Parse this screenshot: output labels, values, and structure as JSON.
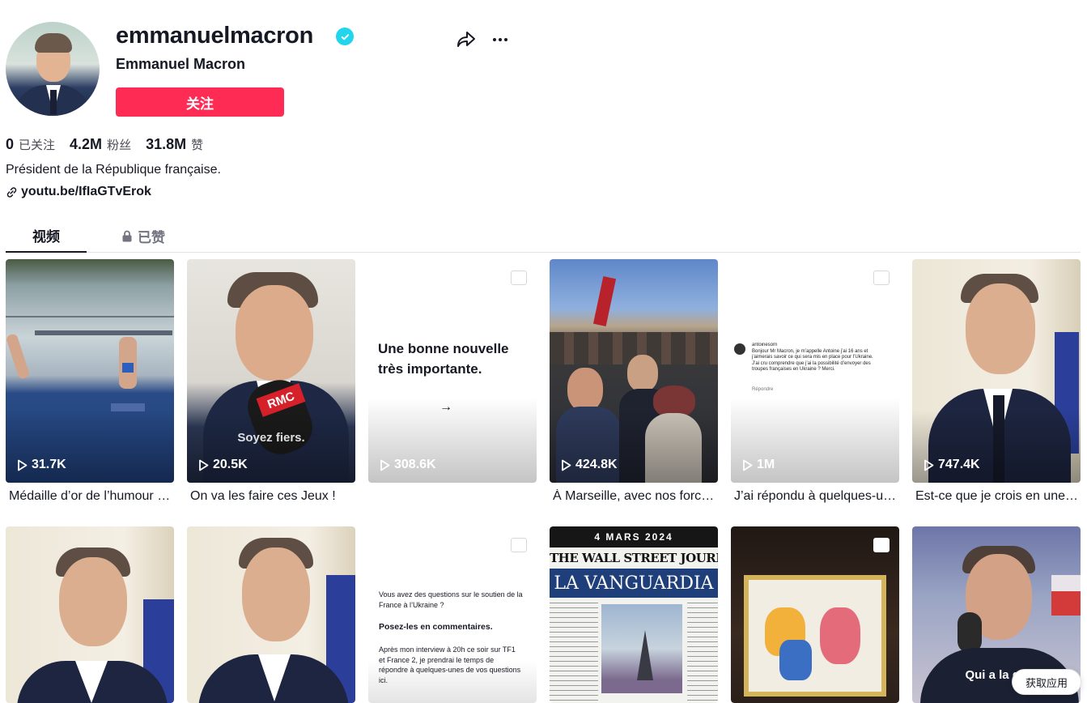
{
  "profile": {
    "username": "emmanuelmacron",
    "nickname": "Emmanuel Macron",
    "follow_label": "关注",
    "bio": "Président de la République française.",
    "link": "youtu.be/IfIaGTvErok"
  },
  "stats": [
    {
      "value": "0",
      "label": "已关注"
    },
    {
      "value": "4.2M",
      "label": "粉丝"
    },
    {
      "value": "31.8M",
      "label": "赞"
    }
  ],
  "tabs": {
    "videos": "视频",
    "liked": "已赞"
  },
  "videos": [
    {
      "views": "31.7K",
      "caption": "Médaille d’or de l’humour des JO"
    },
    {
      "views": "20.5K",
      "caption": "On va les faire ces Jeux !",
      "overlay": "Soyez fiers."
    },
    {
      "views": "308.6K",
      "caption": "",
      "overlay_title": "Une bonne nouvelle très importante.",
      "arrow": "→"
    },
    {
      "views": "424.8K",
      "caption": "À Marseille, avec nos forces de l’ordre"
    },
    {
      "views": "1M",
      "caption": "J’ai répondu à quelques-unes de vos questions",
      "comment": {
        "handle": "antoinesorn",
        "text": "Bonjour Mr Macron, je m’appelle Antoine j’ai 16 ans et j’aimerais savoir ce qui sera mis en place pour l’Ukraine. J’ai cru comprendre que j’ai la possibilité d’envoyer des troupes françaises en Ukraine ? Merci.",
        "reply": "Répondre"
      }
    },
    {
      "views": "747.4K",
      "caption": "Est-ce que je crois en une victoire ?"
    },
    {
      "views": "",
      "caption": ""
    },
    {
      "views": "",
      "caption": ""
    },
    {
      "views": "",
      "caption": "",
      "lines": [
        "Vous avez des questions sur le soutien de la France à l’Ukraine ?",
        "Posez-les en commentaires.",
        "Après mon interview à 20h ce soir sur TF1 et France 2, je prendrai le temps de répondre à quelques-unes de vos questions ici."
      ]
    },
    {
      "views": "",
      "caption": "",
      "date": "4 MARS 2024",
      "paper1": "THE WALL STREET JOURNAL.",
      "paper2": "LA VANGUARDIA"
    },
    {
      "views": "",
      "caption": ""
    },
    {
      "views": "",
      "caption": "",
      "overlay": "Qui a la guerre"
    }
  ],
  "get_app": "获取应用",
  "colors": {
    "accent": "#fe2c55",
    "verified": "#20d5ec"
  },
  "icons": [
    "verified-badge-icon",
    "share-icon",
    "more-icon",
    "link-icon",
    "lock-icon",
    "play-icon",
    "photo-icon",
    "arrow-right-icon"
  ]
}
